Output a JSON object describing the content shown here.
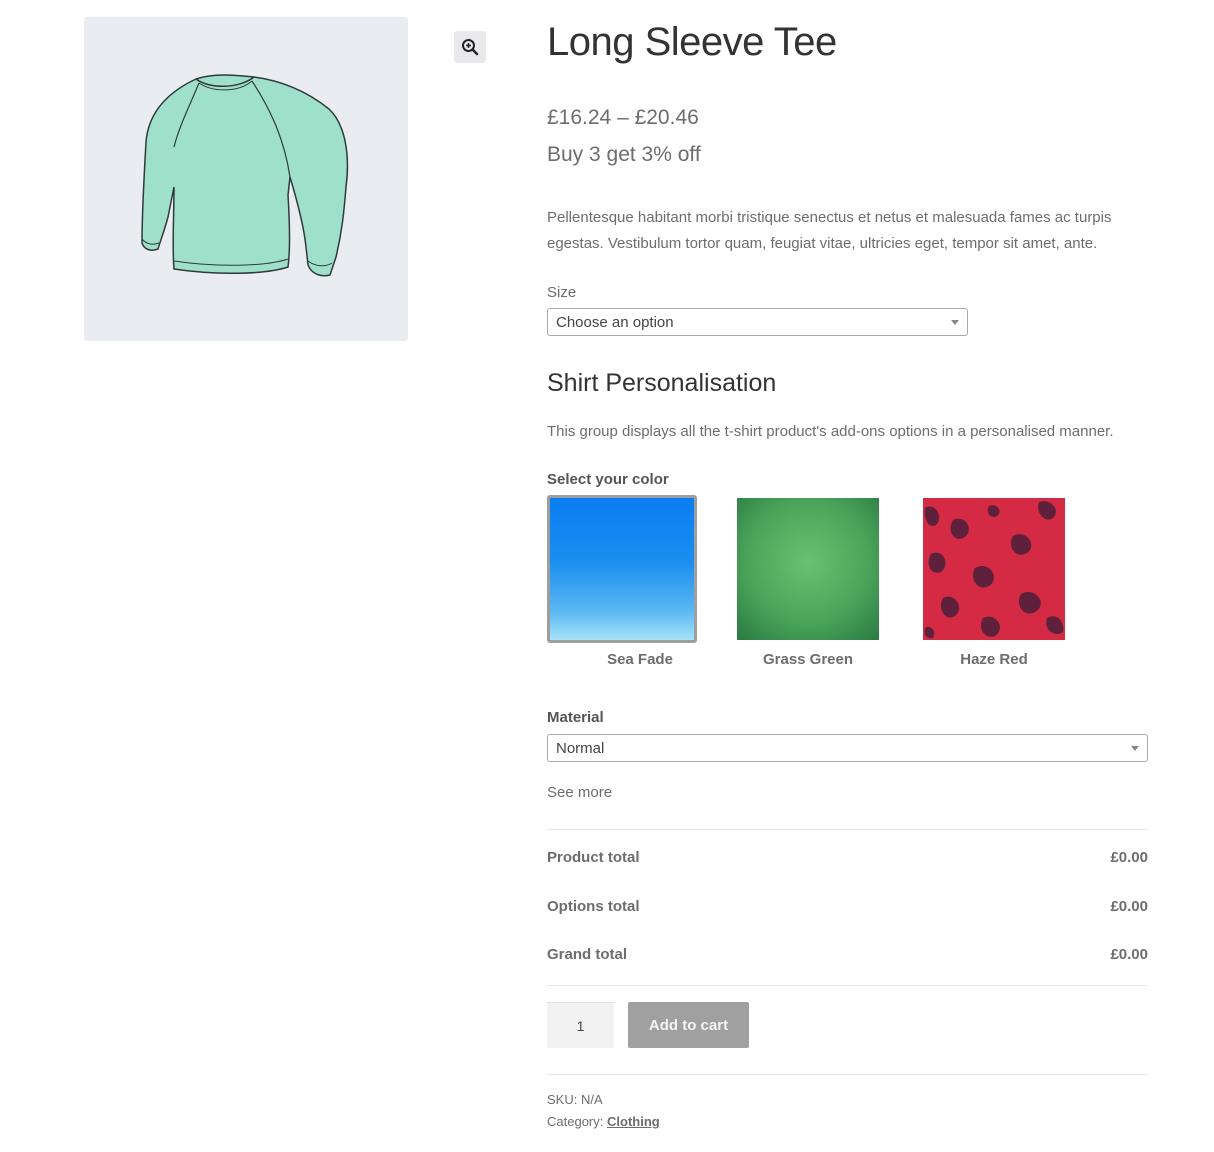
{
  "product": {
    "title": "Long Sleeve Tee",
    "price": "£16.24 – £20.46",
    "offer": "Buy 3 get 3% off",
    "description": "Pellentesque habitant morbi tristique senectus et netus et malesuada fames ac turpis egestas. Vestibulum tortor quam, feugiat vitae, ultricies eget, tempor sit amet, ante."
  },
  "gallery": {
    "zoom_icon": "magnifier-plus-icon",
    "background": "#e9edf1"
  },
  "size": {
    "label": "Size",
    "selected": "Choose an option"
  },
  "personalisation": {
    "title": "Shirt Personalisation",
    "description": "This group displays all the t-shirt product's add-ons options in a personalised manner.",
    "color_label": "Select your color",
    "colors": [
      {
        "name": "Sea Fade",
        "selected": true,
        "color": "#1a8cf0"
      },
      {
        "name": "Grass Green",
        "selected": false,
        "color": "#4aa55a"
      },
      {
        "name": "Haze Red",
        "selected": false,
        "color": "#d42a44"
      }
    ],
    "material_label": "Material",
    "material_selected": "Normal",
    "see_more": "See more"
  },
  "totals": {
    "product_label": "Product total",
    "product_value": "£0.00",
    "options_label": "Options total",
    "options_value": "£0.00",
    "grand_label": "Grand total",
    "grand_value": "£0.00"
  },
  "cart": {
    "quantity": "1",
    "add_label": "Add to cart"
  },
  "meta": {
    "sku_label": "SKU:",
    "sku_value": "N/A",
    "category_label": "Category:",
    "category_value": "Clothing"
  }
}
